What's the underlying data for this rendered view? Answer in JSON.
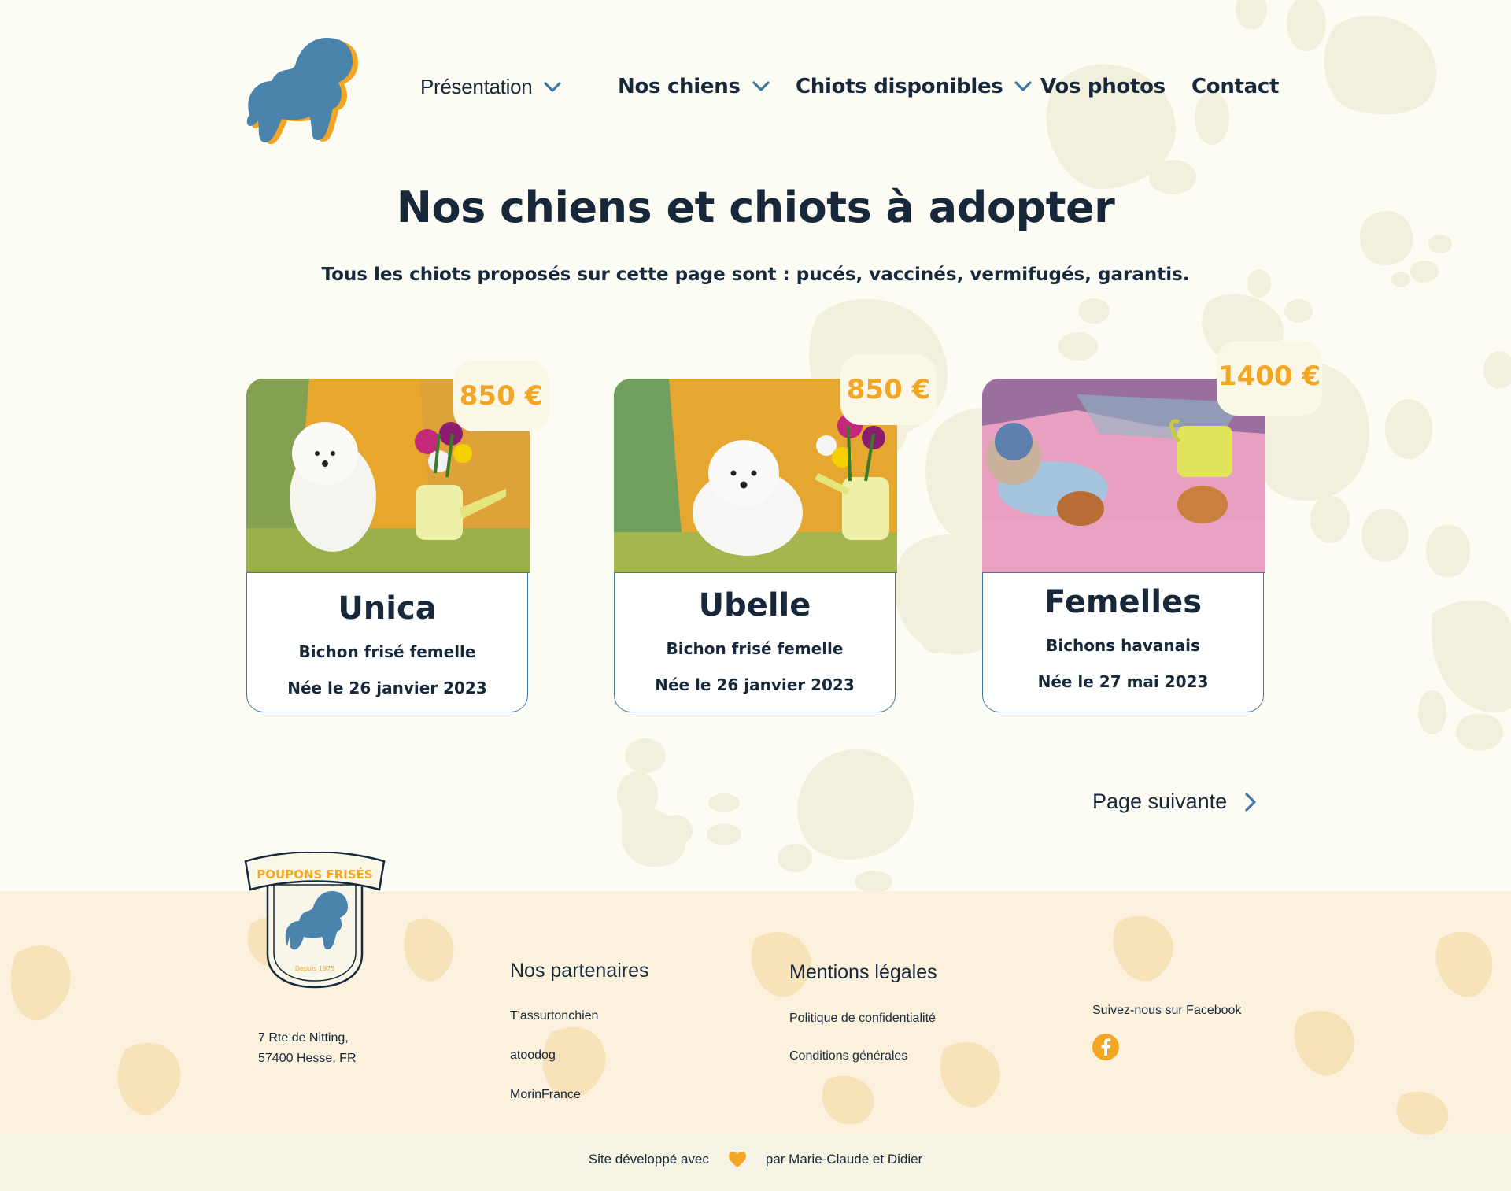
{
  "nav": {
    "items": [
      {
        "label": "Présentation"
      },
      {
        "label": "Nos chiens"
      },
      {
        "label": "Chiots disponibles"
      },
      {
        "label": "Vos photos"
      },
      {
        "label": "Contact"
      }
    ]
  },
  "main": {
    "title": "Nos chiens et chiots à adopter",
    "subtitle": "Tous les chiots proposés sur cette page sont : pucés, vaccinés, vermifugés, garantis.",
    "cards": [
      {
        "name": "Unica",
        "breed": "Bichon frisé femelle",
        "born": "Née le 26 janvier 2023",
        "price": "850 €"
      },
      {
        "name": "Ubelle",
        "breed": "Bichon frisé femelle",
        "born": "Née le 26 janvier 2023",
        "price": "850 €"
      },
      {
        "name": "Femelles",
        "breed": "Bichons havanais",
        "born": "Née le 27 mai 2023",
        "price": "1400 €"
      }
    ],
    "next_label": "Page suivante"
  },
  "footer": {
    "badge_text": "POUPONS FRISÉS",
    "badge_since": "Depuis 1975",
    "address": [
      "7 Rte de Nitting,",
      "57400 Hesse, FR"
    ],
    "partners": {
      "heading": "Nos partenaires",
      "links": [
        "T'assurtonchien",
        "atoodog",
        "MorinFrance"
      ]
    },
    "legal": {
      "heading": "Mentions légales",
      "links": [
        "Politique de confidentialité",
        "Conditions générales"
      ]
    },
    "social": {
      "label": "Suivez-nous sur Facebook",
      "icon": "facebook-icon"
    },
    "credit_before": "Site développé avec",
    "credit_after": "par Marie-Claude et Didier"
  },
  "colors": {
    "accent": "#f3a623",
    "brand_blue": "#4a84ad",
    "text": "#16283a",
    "background": "#fcfbf4"
  }
}
